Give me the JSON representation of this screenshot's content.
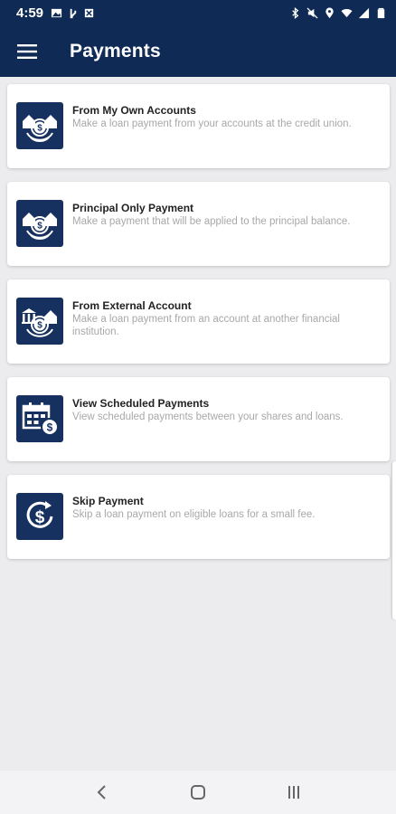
{
  "status_bar": {
    "time": "4:59",
    "left_icons": [
      "image-icon",
      "usb-icon",
      "sim-icon"
    ],
    "right_icons": [
      "bluetooth-icon",
      "mute-icon",
      "location-icon",
      "wifi-icon",
      "signal-icon",
      "battery-icon"
    ]
  },
  "app_bar": {
    "menu_icon": "hamburger-menu-icon",
    "title": "Payments"
  },
  "cards": [
    {
      "icon": "houses-dollar-icon",
      "title": "From My Own Accounts",
      "description": "Make a loan payment from your accounts at the credit union."
    },
    {
      "icon": "houses-dollar-icon",
      "title": "Principal Only Payment",
      "description": "Make a payment that will be applied to the principal balance."
    },
    {
      "icon": "bank-house-dollar-icon",
      "title": "From External Account",
      "description": "Make a loan payment from an account at another financial institution."
    },
    {
      "icon": "calendar-dollar-icon",
      "title": "View Scheduled Payments",
      "description": "View scheduled payments between your shares and loans."
    },
    {
      "icon": "circular-dollar-icon",
      "title": "Skip Payment",
      "description": "Skip a loan payment on eligible loans for a small fee."
    }
  ],
  "nav_bar": {
    "buttons": [
      "back-icon",
      "home-icon",
      "recents-icon"
    ]
  },
  "colors": {
    "primary": "#0f2a55",
    "icon_bg": "#16305f",
    "background": "#ececef",
    "card": "#ffffff",
    "title_text": "#222222",
    "description_text": "#a8a8a8"
  }
}
